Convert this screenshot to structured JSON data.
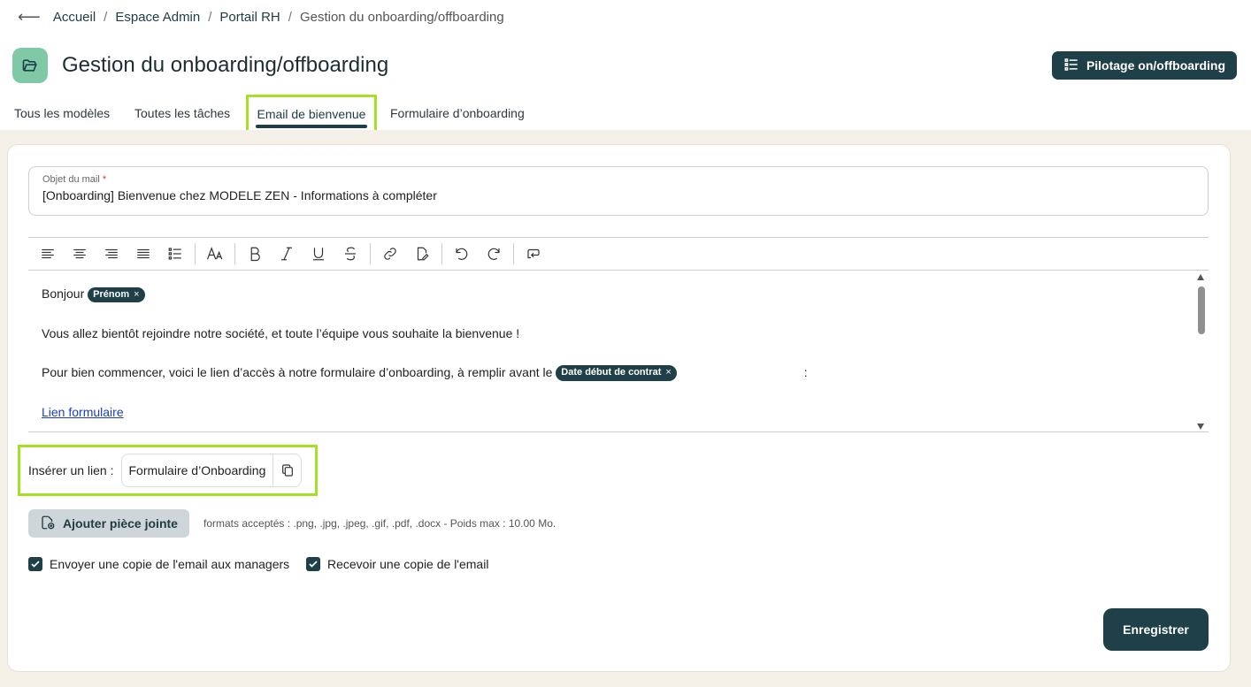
{
  "breadcrumb": {
    "back_icon": "arrow-left-icon",
    "items": [
      "Accueil",
      "Espace Admin",
      "Portail RH"
    ],
    "current": "Gestion du onboarding/offboarding"
  },
  "header": {
    "icon": "folder-open-icon",
    "title": "Gestion du onboarding/offboarding",
    "pilot_button": "Pilotage on/offboarding"
  },
  "tabs": [
    {
      "label": "Tous les modèles"
    },
    {
      "label": "Toutes les tâches"
    },
    {
      "label": "Email de bienvenue",
      "active": true
    },
    {
      "label": "Formulaire d’onboarding"
    }
  ],
  "subject": {
    "label": "Objet du mail",
    "required_mark": "*",
    "value": "[Onboarding] Bienvenue chez MODELE ZEN - Informations à compléter"
  },
  "editor": {
    "greeting": "Bonjour",
    "chip_firstname": "Prénom",
    "line2": "Vous allez bientôt rejoindre notre société, et toute l’équipe vous souhaite la bienvenue !",
    "line3": "Pour bien commencer, voici le lien d’accès à notre formulaire d’onboarding, à remplir avant le",
    "chip_date": "Date début de contrat",
    "line3_end": ":",
    "link": "Lien formulaire",
    "chip_remove": "×"
  },
  "insert_link": {
    "label": "Insérer un lien :",
    "value": "Formulaire d’Onboarding"
  },
  "attachment": {
    "button": "Ajouter pièce jointe",
    "formats": "formats acceptés : .png, .jpg, .jpeg, .gif, .pdf, .docx - Poids max : 10.00 Mo."
  },
  "checkboxes": [
    {
      "label": "Envoyer une copie de l'email aux managers",
      "checked": true
    },
    {
      "label": "Recevoir une copie de l'email",
      "checked": true
    }
  ],
  "save_button": "Enregistrer",
  "colors": {
    "primary": "#1f4048",
    "highlight": "#a6e022",
    "app_icon": "#7fc9a6",
    "background": "#f4efe7"
  }
}
